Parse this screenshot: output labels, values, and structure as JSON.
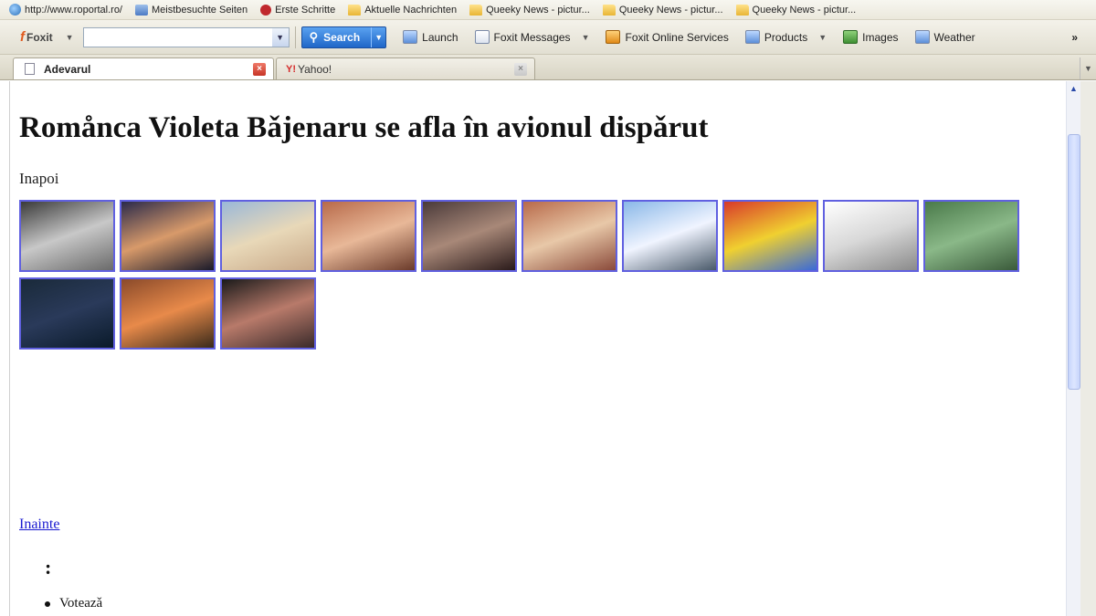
{
  "bookmarks": [
    {
      "label": "http://www.roportal.ro/",
      "icon": "globe-icon",
      "cls": "ic-globe"
    },
    {
      "label": "Meistbesuchte Seiten",
      "icon": "page-icon",
      "cls": "ic-page"
    },
    {
      "label": "Erste Schritte",
      "icon": "red-leaf-icon",
      "cls": "ic-red"
    },
    {
      "label": "Aktuelle Nachrichten",
      "icon": "folder-icon",
      "cls": "ic-folder"
    },
    {
      "label": "Queeky News - pictur...",
      "icon": "folder-icon",
      "cls": "ic-folder"
    },
    {
      "label": "Queeky News - pictur...",
      "icon": "folder-icon",
      "cls": "ic-folder"
    },
    {
      "label": "Queeky News - pictur...",
      "icon": "folder-icon",
      "cls": "ic-folder"
    }
  ],
  "toolbar": {
    "brand": "Foxit",
    "search_value": "",
    "search_label": "Search",
    "items": {
      "launch": "Launch",
      "messages": "Foxit Messages",
      "online": "Foxit Online Services",
      "products": "Products",
      "images": "Images",
      "weather": "Weather"
    },
    "more": "»"
  },
  "tabs": [
    {
      "label": "Adevarul",
      "active": true
    },
    {
      "label": "Yahoo!",
      "active": false
    }
  ],
  "page": {
    "title": "Romånca Violeta Bǎjenaru se afla în avionul dispǎrut",
    "back": "Inapoi",
    "next": "Inainte",
    "colon": ":",
    "vote": "Voteazǎ"
  },
  "thumbnails": [
    {
      "name": "portrait-bw",
      "colors": [
        "#3a3a3a",
        "#c8c8c8",
        "#6a6a6a"
      ]
    },
    {
      "name": "sunset-person",
      "colors": [
        "#2a2a4a",
        "#d89a6a",
        "#1a1a2a"
      ]
    },
    {
      "name": "beach-couple",
      "colors": [
        "#9ab8d8",
        "#e8d8b8",
        "#c8a888"
      ]
    },
    {
      "name": "friends-indoor",
      "colors": [
        "#b86a4a",
        "#e8b898",
        "#6a3a2a"
      ]
    },
    {
      "name": "couple-hug",
      "colors": [
        "#4a3a3a",
        "#a88878",
        "#2a1a1a"
      ]
    },
    {
      "name": "closeup-card",
      "colors": [
        "#b86a4a",
        "#e8c8a8",
        "#8a4a3a"
      ]
    },
    {
      "name": "sky-couple",
      "colors": [
        "#8ab8e8",
        "#f0f4ff",
        "#4a5a6a"
      ]
    },
    {
      "name": "color-panels",
      "colors": [
        "#d83a2a",
        "#f0d030",
        "#3a6ad8"
      ]
    },
    {
      "name": "sketch-face",
      "colors": [
        "#ffffff",
        "#d8d8d8",
        "#8a8a8a"
      ]
    },
    {
      "name": "garden-group",
      "colors": [
        "#4a7a4a",
        "#8ab888",
        "#3a5a3a"
      ]
    },
    {
      "name": "night-person",
      "colors": [
        "#1a2a3a",
        "#2a3a5a",
        "#0a1a2a"
      ]
    },
    {
      "name": "two-men-pub",
      "colors": [
        "#8a4a2a",
        "#e88a4a",
        "#3a2a1a"
      ]
    },
    {
      "name": "woman-dark",
      "colors": [
        "#1a1a1a",
        "#b87a6a",
        "#3a2a2a"
      ]
    }
  ]
}
